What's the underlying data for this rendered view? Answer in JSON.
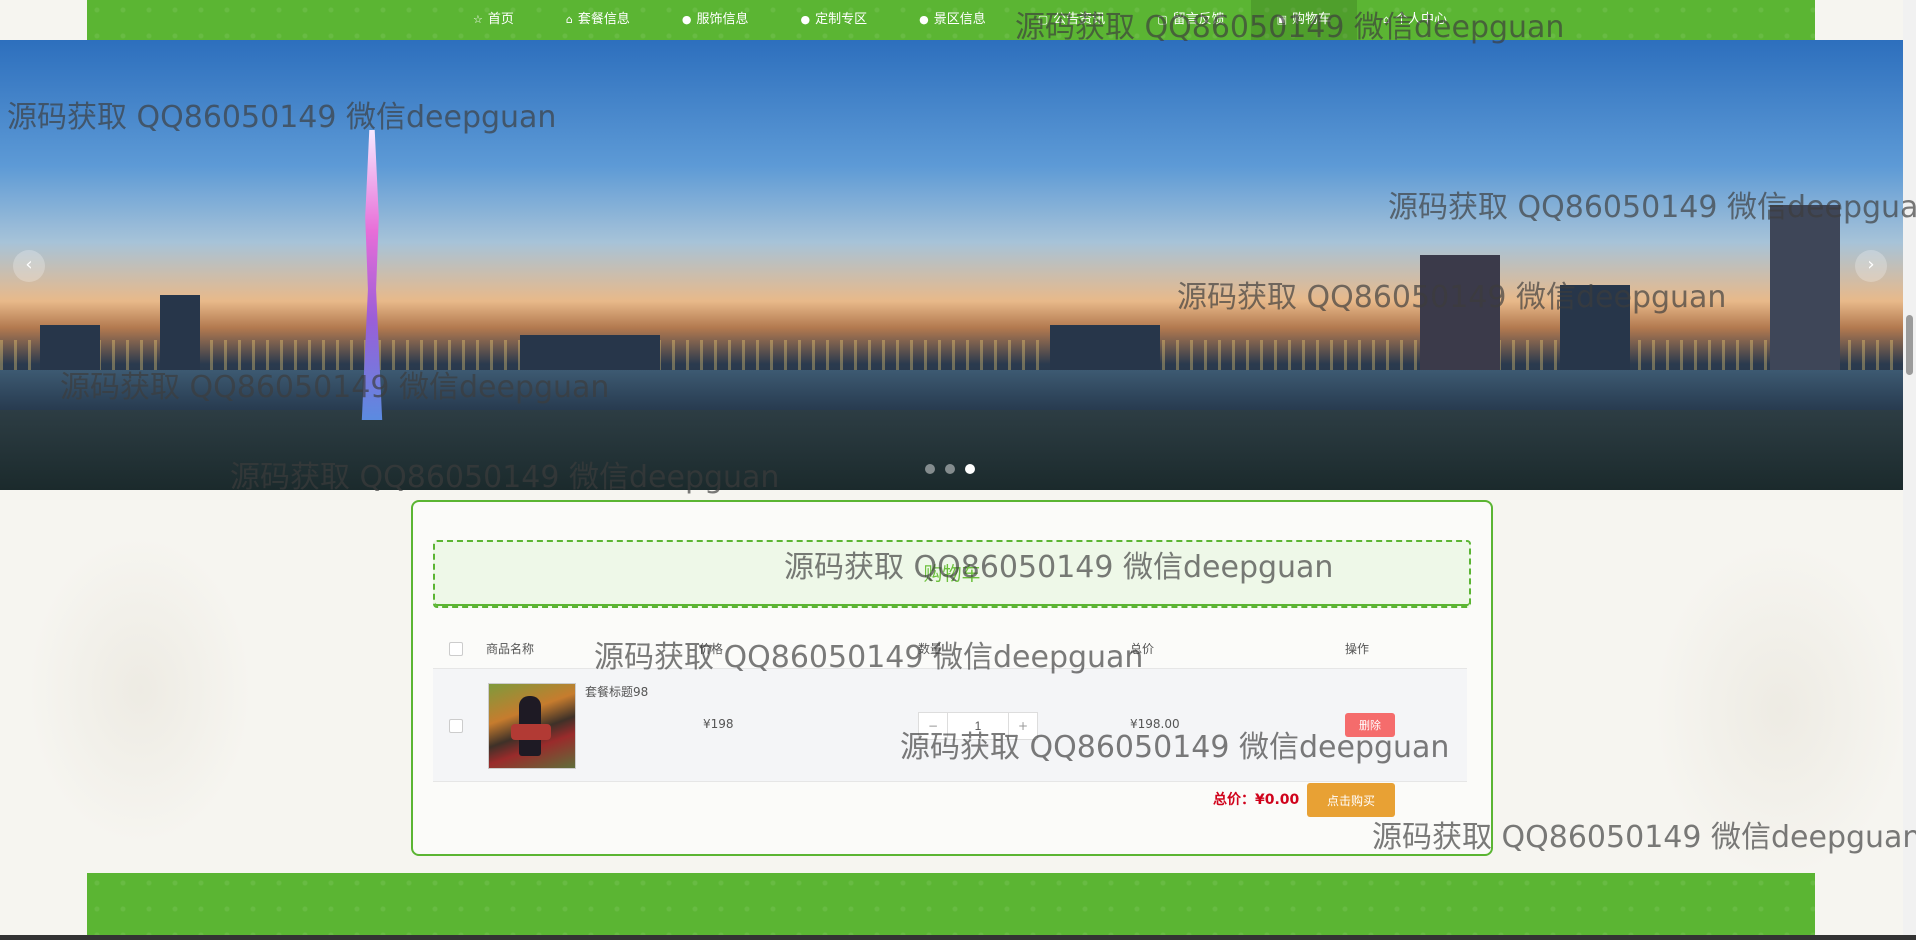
{
  "nav": {
    "items": [
      {
        "icon": "☆",
        "label": "首页"
      },
      {
        "icon": "⌂",
        "label": "套餐信息"
      },
      {
        "icon": "●",
        "label": "服饰信息"
      },
      {
        "icon": "●",
        "label": "定制专区"
      },
      {
        "icon": "●",
        "label": "景区信息"
      },
      {
        "icon": "▢",
        "label": "公告资讯"
      },
      {
        "icon": "▢",
        "label": "留言反馈"
      },
      {
        "icon": "▣",
        "label": "购物车"
      },
      {
        "icon": "⌂",
        "label": "个人中心"
      }
    ]
  },
  "banner": {
    "prev": "‹",
    "next": "›",
    "slides": 3,
    "active_slide": 3
  },
  "cart": {
    "title": "购物车",
    "headers": {
      "name": "商品名称",
      "price": "价格",
      "quantity": "数量",
      "total": "总价",
      "action": "操作"
    },
    "items": [
      {
        "name": "套餐标题98",
        "price": "¥198",
        "quantity": "1",
        "total": "¥198.00",
        "delete_label": "删除",
        "minus": "−",
        "plus": "+"
      }
    ],
    "total_label": "总价：¥0.00",
    "buy_label": "点击购买"
  },
  "watermark": {
    "text": "源码获取 QQ86050149 微信deepguan"
  },
  "colors": {
    "brand_green": "#5bb533",
    "delete_red": "#f56c6c",
    "buy_orange": "#e8a134",
    "total_red": "#d0021b"
  }
}
